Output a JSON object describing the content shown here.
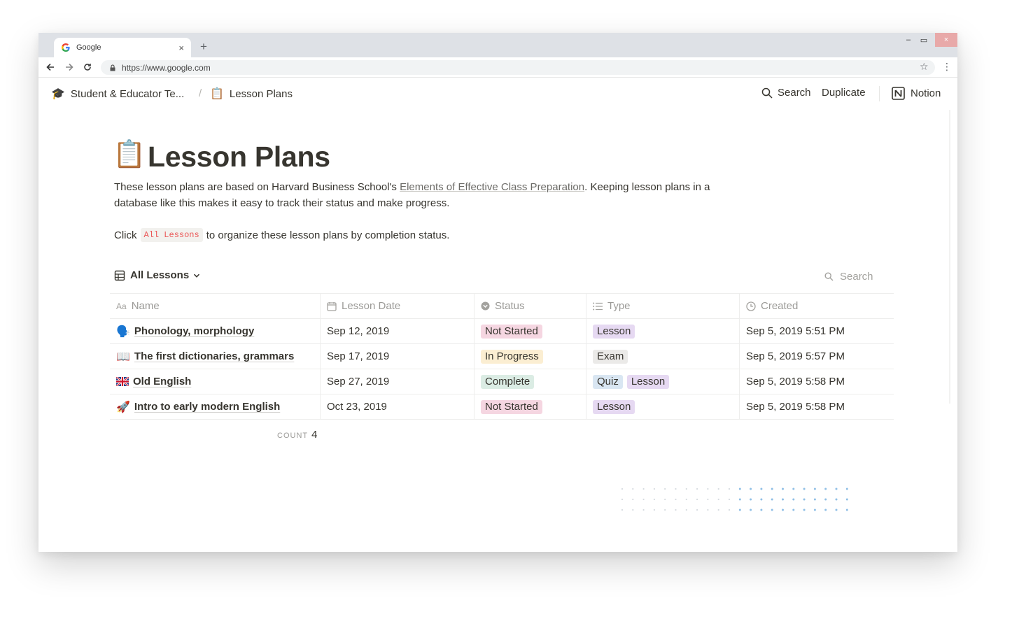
{
  "browser": {
    "tab_title": "Google",
    "new_tab": "+",
    "url": "https://www.google.com",
    "window_controls": {
      "minimize": "–",
      "maximize": "▭",
      "close": "×"
    }
  },
  "topbar": {
    "breadcrumb": [
      {
        "emoji": "🎓",
        "label": "Student & Educator Te..."
      },
      {
        "emoji": "📋",
        "label": "Lesson Plans"
      }
    ],
    "separator": "/",
    "search_label": "Search",
    "duplicate_label": "Duplicate",
    "notion_label": "Notion"
  },
  "page": {
    "icon": "📋",
    "title": "Lesson Plans",
    "desc_before": "These lesson plans are based on Harvard Business School's ",
    "desc_link": "Elements of Effective Class Preparation",
    "desc_after": ". Keeping lesson plans in a database like this makes it easy to track their status and make progress.",
    "desc2_before": "Click",
    "desc2_code": "All Lessons",
    "desc2_after": "to organize these lesson plans by completion status."
  },
  "database": {
    "view_name": "All Lessons",
    "search_placeholder": "Search",
    "columns": [
      {
        "icon": "text-icon",
        "label": "Name"
      },
      {
        "icon": "calendar-icon",
        "label": "Lesson Date"
      },
      {
        "icon": "select-icon",
        "label": "Status"
      },
      {
        "icon": "list-icon",
        "label": "Type"
      },
      {
        "icon": "clock-icon",
        "label": "Created"
      }
    ],
    "rows": [
      {
        "emoji": "🗣️",
        "name": "Phonology, morphology",
        "date": "Sep 12, 2019",
        "status": "Not Started",
        "types": [
          "Lesson"
        ],
        "created": "Sep 5, 2019 5:51 PM"
      },
      {
        "emoji": "📖",
        "name": "The first dictionaries, grammars",
        "date": "Sep 17, 2019",
        "status": "In Progress",
        "types": [
          "Exam"
        ],
        "created": "Sep 5, 2019 5:57 PM"
      },
      {
        "emoji": "🇬🇧",
        "name": "Old English",
        "date": "Sep 27, 2019",
        "status": "Complete",
        "types": [
          "Quiz",
          "Lesson"
        ],
        "created": "Sep 5, 2019 5:58 PM"
      },
      {
        "emoji": "🚀",
        "name": "Intro to early modern English",
        "date": "Oct 23, 2019",
        "status": "Not Started",
        "types": [
          "Lesson"
        ],
        "created": "Sep 5, 2019 5:58 PM"
      }
    ],
    "count_label": "COUNT",
    "count_value": "4"
  },
  "colors": {
    "status": {
      "Not Started": "#f5d6e1",
      "In Progress": "#fbeed2",
      "Complete": "#dbece4"
    },
    "type": {
      "Lesson": "#e6d9f2",
      "Exam": "#ebeae8",
      "Quiz": "#d9e6f2"
    }
  }
}
